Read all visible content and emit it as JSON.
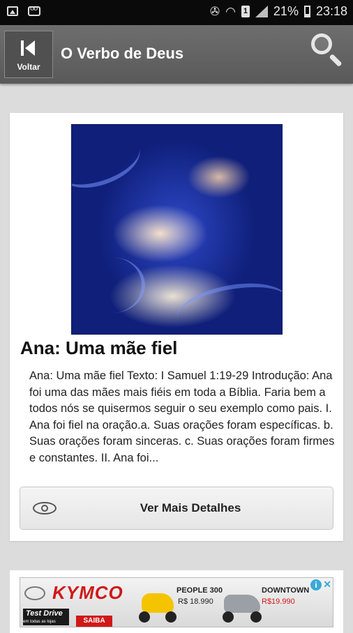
{
  "status_bar": {
    "battery": "21%",
    "time": "23:18",
    "sim": "1"
  },
  "app_bar": {
    "back_label": "Voltar",
    "title": "O Verbo de Deus"
  },
  "article": {
    "title": "Ana: Uma mãe fiel",
    "description": "Ana: Uma mãe fiel Texto: I Samuel 1:19-29 Introdução: Ana foi uma das mães mais fiéis em toda a Bíblia. Faria bem a todos nós se quisermos seguir o seu exemplo como pais. I. Ana foi fiel na oração.a. Suas orações foram específicas. b. Suas orações foram sinceras. c. Suas orações foram firmes e constantes. II. Ana foi...",
    "details_button": "Ver Mais Detalhes"
  },
  "ad": {
    "brand": "KYMCO",
    "test_drive": "Test Drive",
    "test_drive_sub": "em todas as lojas",
    "cta": "SAIBA MAIS!",
    "model1": "PEOPLE 300",
    "price1": "R$ 18.990",
    "model2": "DOWNTOWN",
    "price2": "R$19.990"
  },
  "colors": {
    "app_bar": "#5f5f5f",
    "status_bar": "#0a0a0a",
    "background": "#dcdcdc",
    "ad_red": "#d01818"
  }
}
